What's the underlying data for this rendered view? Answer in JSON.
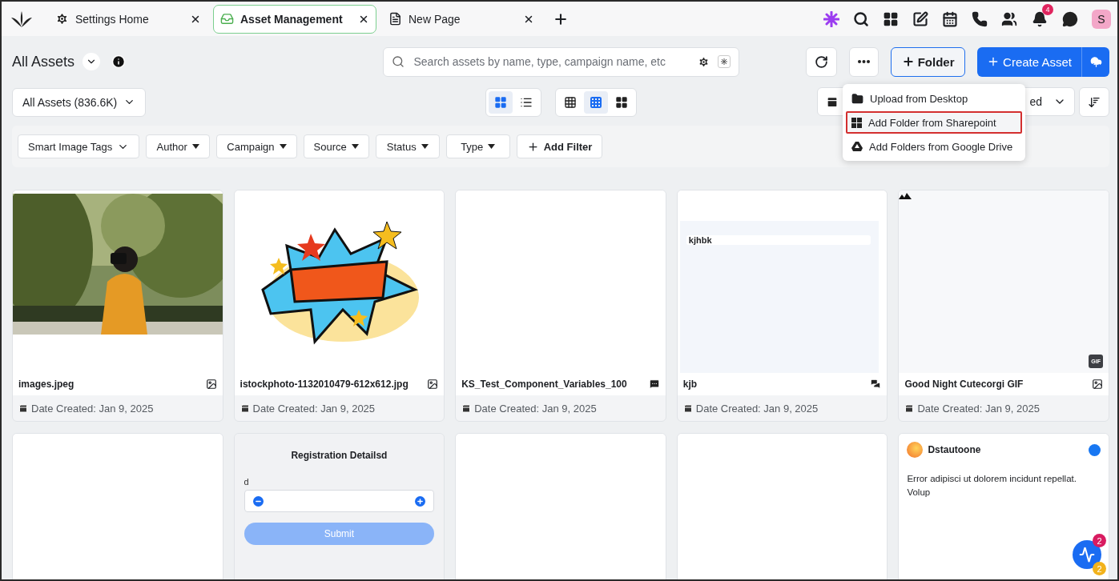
{
  "tabs": [
    {
      "label": "Settings Home",
      "selected": false
    },
    {
      "label": "Asset Management",
      "selected": true
    },
    {
      "label": "New Page",
      "selected": false
    }
  ],
  "notifications": {
    "count": "4"
  },
  "avatar": {
    "initial": "S"
  },
  "header": {
    "title": "All Assets",
    "search": {
      "placeholder": "Search assets by name, type, campaign name, etc"
    },
    "folder_button": "Folder",
    "create_button": "Create Asset"
  },
  "scope_dropdown": "All Assets (836.6K)",
  "view_modes": [
    {
      "kind": "grid",
      "selected": true
    },
    {
      "kind": "list",
      "selected": false
    }
  ],
  "density": [
    {
      "kind": "small",
      "selected": false
    },
    {
      "kind": "medium",
      "selected": true
    },
    {
      "kind": "large",
      "selected": false
    }
  ],
  "sort_dropdown": "ed",
  "menu": {
    "items": [
      {
        "label": "Upload from Desktop",
        "selected": false
      },
      {
        "label": "Add Folder from Sharepoint",
        "selected": true
      },
      {
        "label": "Add Folders from Google Drive",
        "selected": false
      }
    ]
  },
  "filters": [
    {
      "label": "Smart Image Tags",
      "kind": "chevron"
    },
    {
      "label": "Author",
      "kind": "caret"
    },
    {
      "label": "Campaign",
      "kind": "caret"
    },
    {
      "label": "Source",
      "kind": "caret"
    },
    {
      "label": "Status",
      "kind": "caret"
    },
    {
      "label": "Type",
      "kind": "caret"
    }
  ],
  "add_filter": "Add Filter",
  "assets": [
    {
      "name": "images.jpeg",
      "date": "Date Created: Jan 9, 2025"
    },
    {
      "kind": "illustration",
      "name": "istockphoto-1132010479-612x612.jpg",
      "date": "Date Created: Jan 9, 2025"
    },
    {
      "kind": "blank",
      "name": "KS_Test_Component_Variables_100",
      "date": "Date Created: Jan 9, 2025"
    },
    {
      "kind": "document",
      "preview_text": "kjhbk",
      "name": "kjb",
      "date": "Date Created: Jan 9, 2025"
    },
    {
      "kind": "gif",
      "badge": "GIF",
      "name": "Good Night Cutecorgi GIF",
      "date": "Date Created: Jan 9, 2025"
    },
    {
      "kind": "blank"
    },
    {
      "kind": "form",
      "title": "Registration Detailsd",
      "field_label": "d",
      "button": "Submit"
    },
    {
      "kind": "blank"
    },
    {
      "kind": "blank"
    },
    {
      "kind": "post",
      "author": "Dstautoone",
      "text": "Error adipisci ut dolorem incidunt repellat. Volup"
    }
  ],
  "fab": {
    "badges": [
      {
        "count": "2",
        "color": "#d81b60"
      },
      {
        "count": "2",
        "color": "#f2b21b"
      }
    ]
  }
}
